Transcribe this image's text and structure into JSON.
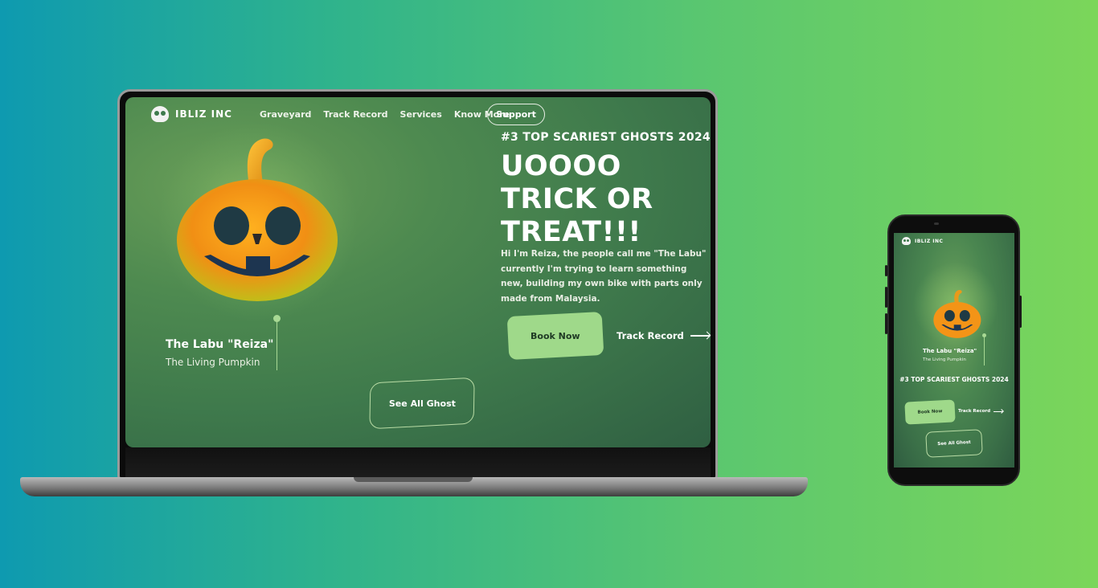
{
  "site": {
    "brand": "IBLIZ INC",
    "nav": [
      "Graveyard",
      "Track Record",
      "Services",
      "Know More"
    ],
    "support_label": "Support"
  },
  "hero": {
    "tagline": "#3 TOP SCARIEST GHOSTS 2024",
    "headline_lines": [
      "UOOOO",
      "TRICK OR",
      "TREAT!!!"
    ],
    "bio": "Hi I'm Reiza, the people call me \"The Labu\" currently I'm trying to learn something new, building my own bike with parts only made from Malaysia.",
    "book_label": "Book Now",
    "track_label": "Track Record"
  },
  "character": {
    "name": "The Labu \"Reiza\"",
    "subtitle": "The Living Pumpkin"
  },
  "see_all_label": "See All Ghost",
  "colors": {
    "accent": "#9fd98a",
    "screen_bg": "#3f7a4c",
    "text": "#ffffff"
  },
  "icons": [
    "skull-icon",
    "pumpkin-icon",
    "arrow-right-icon"
  ]
}
